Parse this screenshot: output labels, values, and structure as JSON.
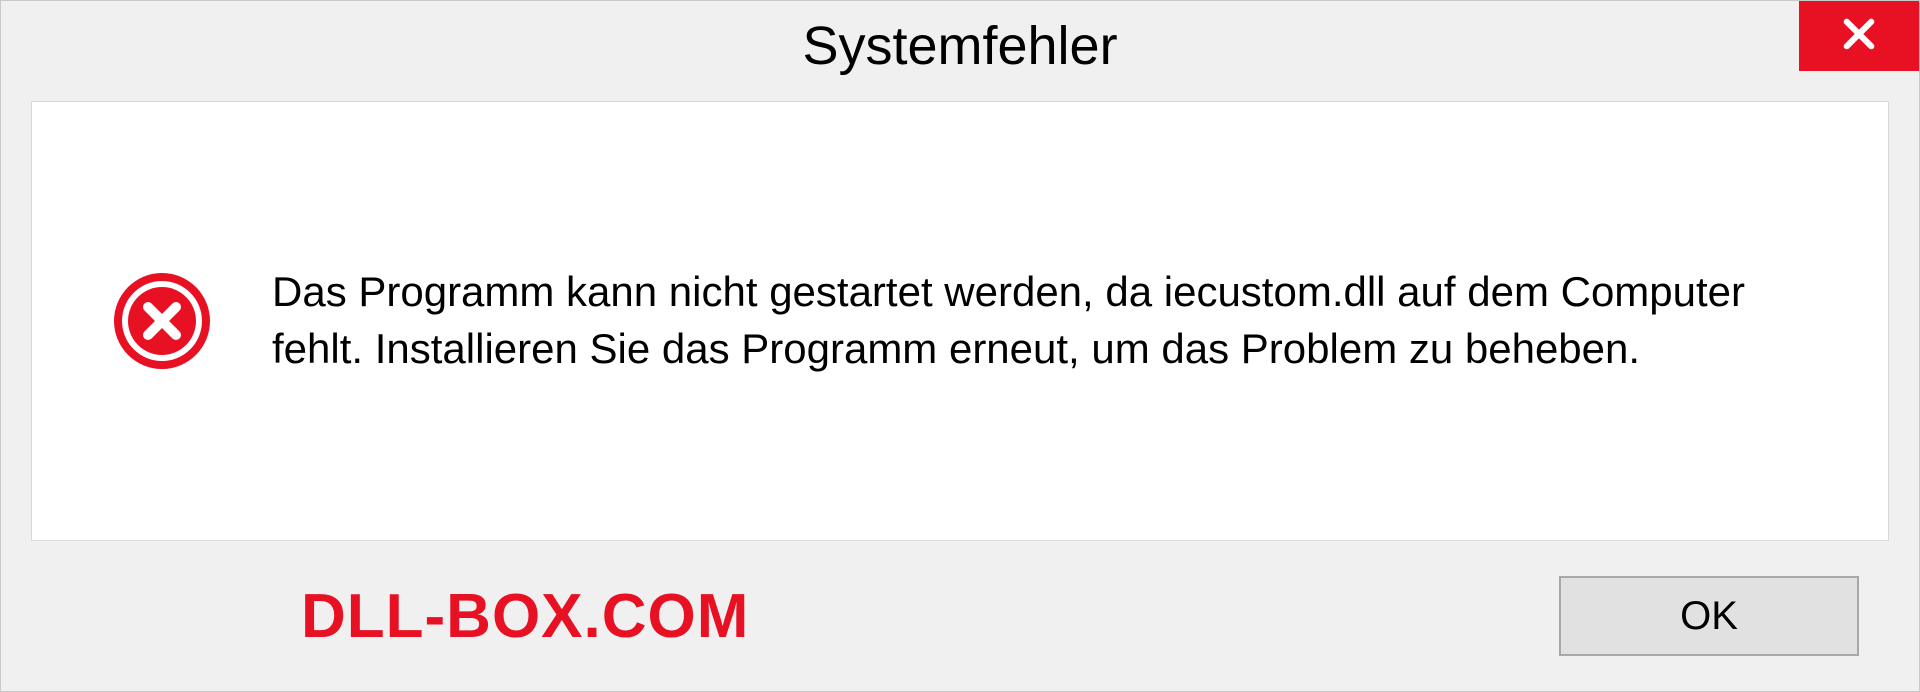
{
  "dialog": {
    "title": "Systemfehler",
    "message": "Das Programm kann nicht gestartet werden, da iecustom.dll auf dem Computer fehlt. Installieren Sie das Programm erneut, um das Problem zu beheben.",
    "ok_label": "OK"
  },
  "watermark": "DLL-BOX.COM"
}
